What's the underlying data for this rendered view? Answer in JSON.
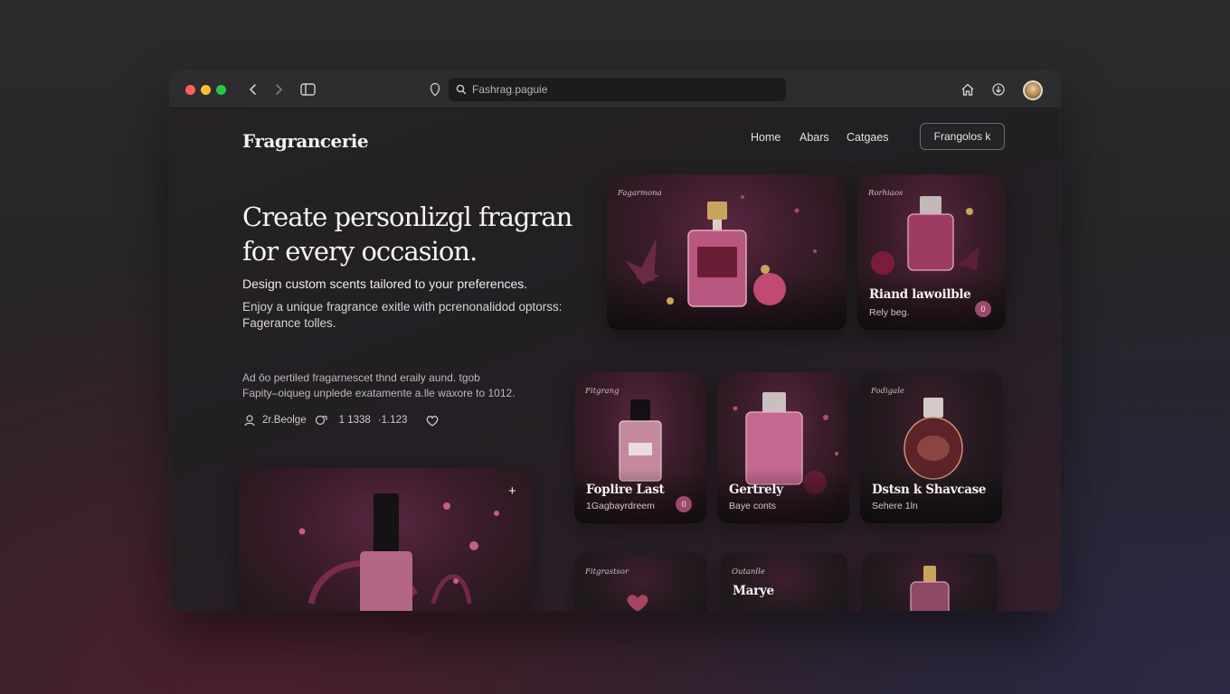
{
  "browser": {
    "address": "Fashrag.paguie"
  },
  "site": {
    "brand": "Fragrancerie",
    "nav": [
      "Home",
      "Abars",
      "Catgaes"
    ],
    "nav_button": "Frangolos k"
  },
  "hero": {
    "title": "Create personlizgl fragran\nfor every occasion.",
    "subtitle": "Design custom scents tailored to your preferences.",
    "body": "Enjoy a unique fragrance exitle with pcrenonalidod optorss:\nFagerance tolles.",
    "meta": "Ad ǒo pertiled fragarnescet thnd eraily aund. tgob\nFapity–oiqueg unplede exatamente a.lle waxore to 1012.",
    "stats": [
      "2r.Beolge",
      "1 1338",
      "·1.123"
    ]
  },
  "cards": [
    {
      "tag": "Fagarmona",
      "title": "",
      "sub": ""
    },
    {
      "tag": "Rorhiaos",
      "title": "Riand lawoilble",
      "sub": "Rely beg.",
      "badge": "0"
    },
    {
      "tag": "Fitgrang",
      "title": "Foplire Last",
      "sub": "1Gagbayrdreem",
      "badge": "0"
    },
    {
      "tag": "",
      "title": "Gertrely",
      "sub": "Baye conts"
    },
    {
      "tag": "Fodigale",
      "title": "Dstsn k Shavcase",
      "sub": "Sehere 1ln"
    },
    {
      "tag": "Fitgrastsor",
      "title": "",
      "sub": ""
    },
    {
      "tag": "Outanlle",
      "title": "Marye",
      "sub": ""
    },
    {
      "tag": "",
      "title": "",
      "sub": ""
    }
  ],
  "colors": {
    "accent": "#9a4b6b",
    "bottle_pink": "#c76a8e",
    "gold": "#c9a45c"
  },
  "icons": [
    "back-icon",
    "forward-icon",
    "sidebar-icon",
    "privacy-icon",
    "search-icon",
    "home-icon",
    "download-icon",
    "user-icon",
    "heart-icon",
    "plus-icon"
  ]
}
